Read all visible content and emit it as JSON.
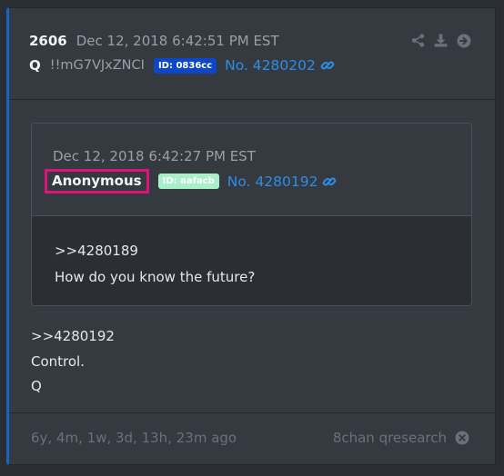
{
  "post": {
    "number": "2606",
    "date": "Dec 12, 2018 6:42:51 PM EST",
    "name": "Q",
    "tripcode": "!!mG7VJxZNCI",
    "id_badge": "ID: 0836cc",
    "post_link": "No. 4280202",
    "body_lines": [
      ">>4280192",
      "Control.",
      "Q"
    ],
    "actions": [
      "share-icon",
      "download-icon",
      "arrow-right-circle-icon"
    ]
  },
  "quoted": {
    "date": "Dec 12, 2018 6:42:27 PM EST",
    "name": "Anonymous",
    "id_badge": "ID: aafacb",
    "post_link": "No. 4280192",
    "body_lines": [
      ">>4280189",
      "How do you know the future?"
    ]
  },
  "footer": {
    "age": "6y, 4m, 1w, 3d, 13h, 23m ago",
    "source": "8chan qresearch"
  },
  "colors": {
    "accent": "#1565c0",
    "link": "#2e8de6",
    "id_blue": "#0d47c9",
    "id_mint": "#a8f0c8",
    "highlight": "#e0137a"
  }
}
